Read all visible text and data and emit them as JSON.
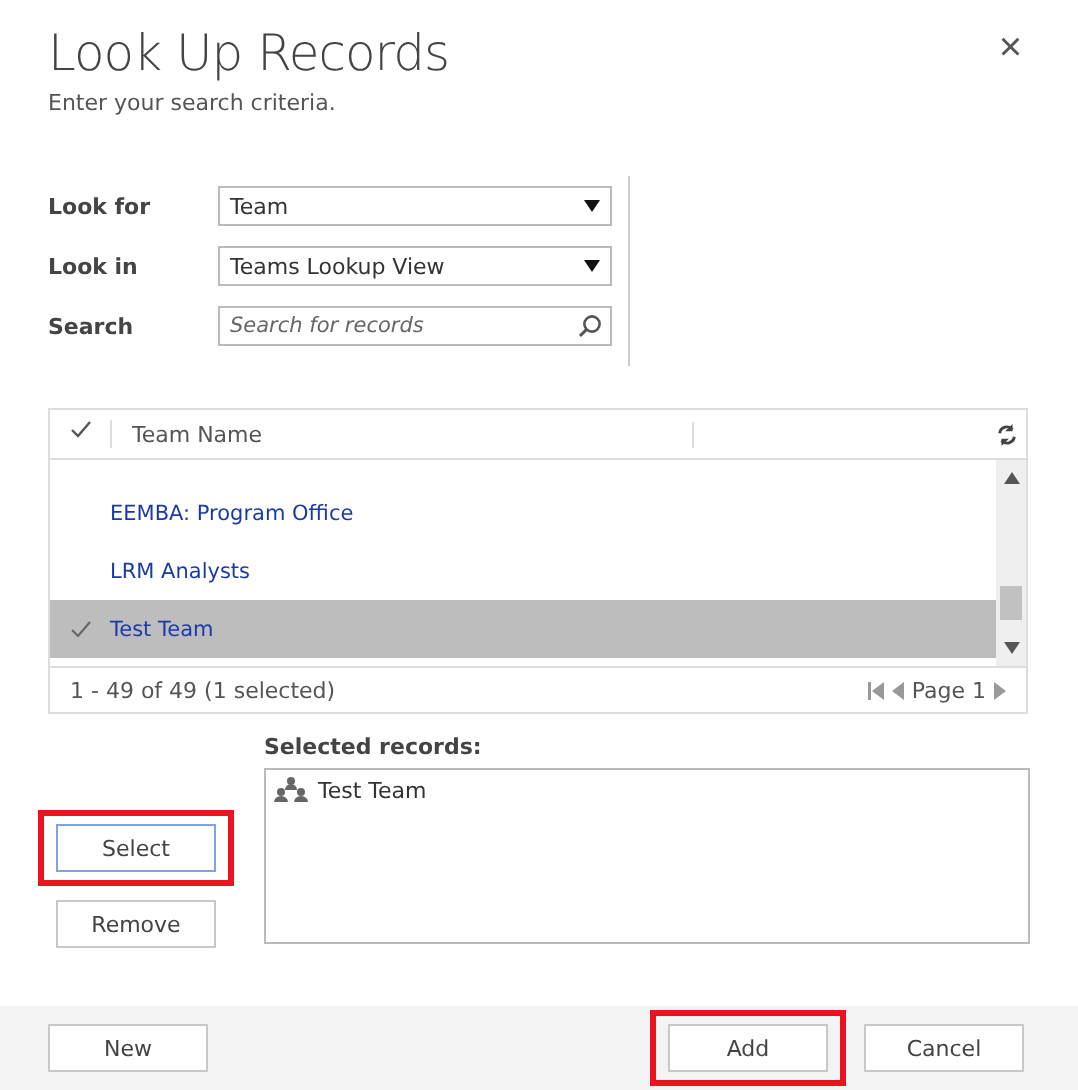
{
  "dialog": {
    "title": "Look Up Records",
    "subtitle": "Enter your search criteria.",
    "close": "×"
  },
  "criteria": [
    {
      "label": "Look for",
      "kind": "dropdown",
      "value": "Team"
    },
    {
      "label": "Look in",
      "kind": "dropdown",
      "value": "Teams Lookup View"
    },
    {
      "label": "Search",
      "kind": "search",
      "placeholder": "Search for records"
    }
  ],
  "grid": {
    "columns": [
      "Team Name"
    ],
    "rows": [
      {
        "name": "EEMBA: Program Office",
        "selected": false
      },
      {
        "name": "LRM Analysts",
        "selected": false
      },
      {
        "name": "Test Team",
        "selected": true
      }
    ],
    "status": "1 - 49 of 49 (1 selected)",
    "page": "Page 1"
  },
  "selected_records": {
    "label": "Selected records:",
    "items": [
      "Test Team"
    ]
  },
  "side_buttons": [
    {
      "label": "Select",
      "highlighted": true,
      "focused": true
    },
    {
      "label": "Remove",
      "highlighted": false,
      "focused": false
    }
  ],
  "footer_left": [
    {
      "label": "New",
      "highlighted": false
    }
  ],
  "footer_right": [
    {
      "label": "Add",
      "highlighted": true
    },
    {
      "label": "Cancel",
      "highlighted": false
    }
  ]
}
